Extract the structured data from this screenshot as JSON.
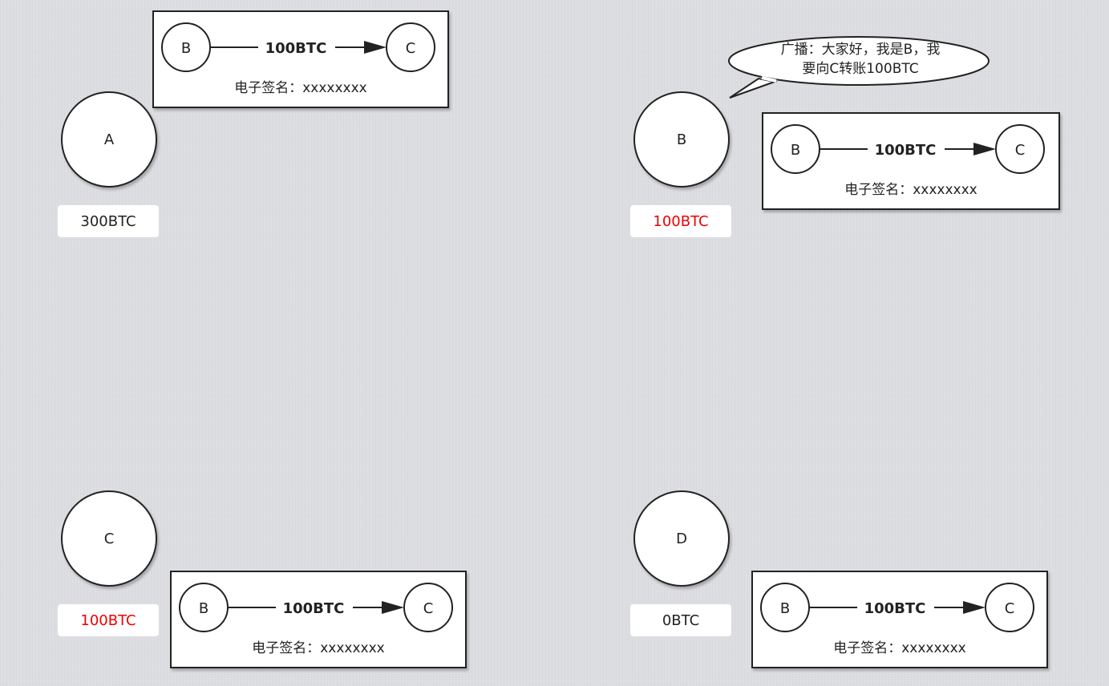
{
  "nodes": [
    {
      "id": "A",
      "label": "A",
      "balance": "300BTC",
      "highlight": false
    },
    {
      "id": "B",
      "label": "B",
      "balance": "100BTC",
      "highlight": true
    },
    {
      "id": "C",
      "label": "C",
      "balance": "100BTC",
      "highlight": true
    },
    {
      "id": "D",
      "label": "D",
      "balance": "0BTC",
      "highlight": false
    }
  ],
  "transaction": {
    "from": "B",
    "to": "C",
    "amount": "100BTC",
    "signature": "电子签名：xxxxxxxx"
  },
  "broadcast": {
    "line1": "广播：大家好，我是B，我",
    "line2": "要向C转账100BTC"
  },
  "colors": {
    "highlight": "#ee0000",
    "stroke": "#222222",
    "background": "#dcdde1"
  }
}
